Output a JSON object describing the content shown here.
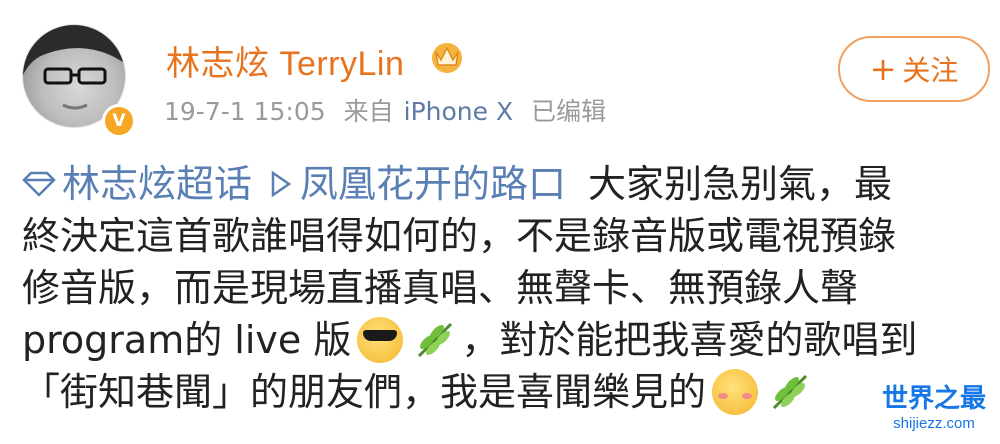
{
  "post": {
    "username": "林志炫 TerryLin",
    "verified_badge": "V",
    "date": "19-7-1 15:05",
    "source_prefix": "来自",
    "source": "iPhone X",
    "edited": "已编辑",
    "follow_label": "关注",
    "follow_plus": "+"
  },
  "content": {
    "topic_link": "林志炫超话",
    "place_link": "凤凰花开的路口",
    "line1_text": "大家别急别氣，最",
    "line2_text": "終決定這首歌誰唱得如何的，不是錄音版或電視預錄",
    "line3_text": "修音版，而是現場直播真唱、無聲卡、無預錄人聲",
    "line4_text_a": "program的 live 版",
    "line4_text_b": "，對於能把我喜愛的歌唱到",
    "line5_text": "「街知巷聞」的朋友們，我是喜聞樂見的"
  },
  "watermark": {
    "title": "世界之最",
    "url": "shijiezz.com"
  },
  "colors": {
    "username": "#e8731f",
    "link": "#5a7fb5",
    "meta": "#9a9a9a",
    "watermark": "#1677e8"
  }
}
